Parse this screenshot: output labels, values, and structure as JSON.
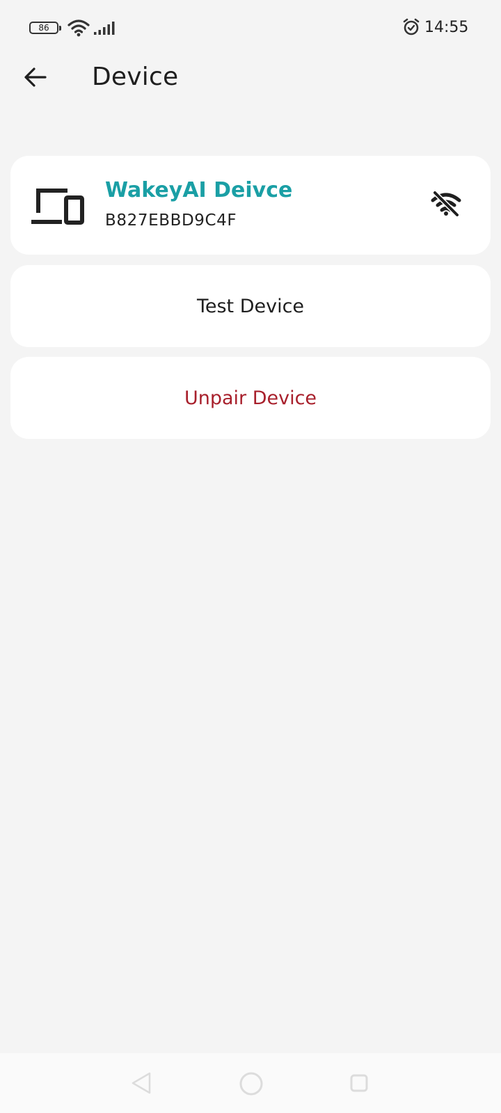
{
  "status_bar": {
    "battery_level": "86",
    "time": "14:55",
    "icons": [
      "battery-icon",
      "wifi-icon",
      "signal-icon",
      "alarm-icon"
    ]
  },
  "app_bar": {
    "title": "Device",
    "back_icon": "arrow-left-icon"
  },
  "device": {
    "name": "WakeyAI Deivce",
    "id": "B827EBBD9C4F",
    "icon": "devices-icon",
    "connection_icon": "wifi-off-icon"
  },
  "actions": {
    "test_label": "Test Device",
    "unpair_label": "Unpair Device"
  },
  "colors": {
    "background": "#f4f4f4",
    "card": "#ffffff",
    "accent": "#1a9fa5",
    "danger": "#a8202c"
  },
  "nav_bar": {
    "icons": [
      "nav-back-icon",
      "nav-home-icon",
      "nav-recents-icon"
    ]
  }
}
